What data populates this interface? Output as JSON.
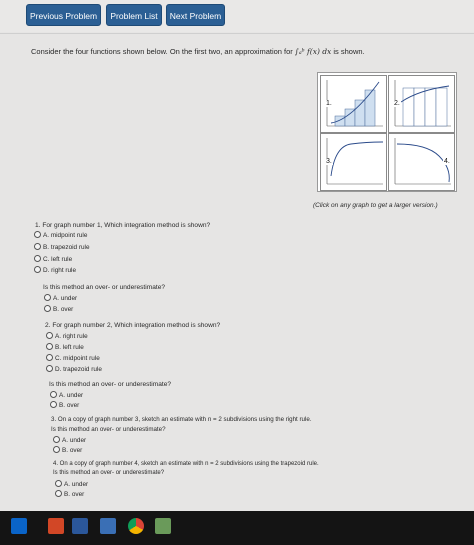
{
  "nav": {
    "previous_label": "Previous Problem",
    "list_label": "Problem List",
    "next_label": "Next Problem"
  },
  "prompt": {
    "text_before": "Consider the four functions shown below. On the first two, an approximation for",
    "integral": "∫ₐᵇ f(x) dx",
    "text_after": "is shown."
  },
  "graphs": {
    "labels": [
      "1.",
      "2.",
      "3.",
      "4."
    ],
    "caption": "(Click on any graph to get a larger version.)"
  },
  "questions": {
    "q1": {
      "text": "1. For graph number 1, Which integration method is shown?",
      "options": [
        "A. midpoint rule",
        "B. trapezoid rule",
        "C. left rule",
        "D. right rule"
      ]
    },
    "q1b": {
      "text": "Is this method an over- or underestimate?",
      "options": [
        "A. under",
        "B. over"
      ]
    },
    "q2": {
      "text": "2. For graph number 2, Which integration method is shown?",
      "options": [
        "A. right rule",
        "B. left rule",
        "C. midpoint rule",
        "D. trapezoid rule"
      ]
    },
    "q2b": {
      "text": "Is this method an over- or underestimate?",
      "options": [
        "A. under",
        "B. over"
      ]
    },
    "q3": {
      "line1": "3. On a copy of graph number 3, sketch an estimate with n = 2 subdivisions using the right rule.",
      "line2": "Is this method an over- or underestimate?",
      "options": [
        "A. under",
        "B. over"
      ]
    },
    "q4": {
      "line1": "4. On a copy of graph number 4, sketch an estimate with n = 2 subdivisions using the trapezoid rule.",
      "line2": "Is this method an over- or underestimate?",
      "options": [
        "A. under",
        "B. over"
      ]
    }
  },
  "taskbar": {
    "items": [
      "outlook-icon",
      "powerpoint-icon",
      "word-icon",
      "app-icon",
      "chrome-icon",
      "app-grid-icon"
    ],
    "colors": [
      "#0a64c8",
      "#d24726",
      "#2b579a",
      "#3a6fb5",
      "#dddddd",
      "#6a9a5a"
    ]
  }
}
